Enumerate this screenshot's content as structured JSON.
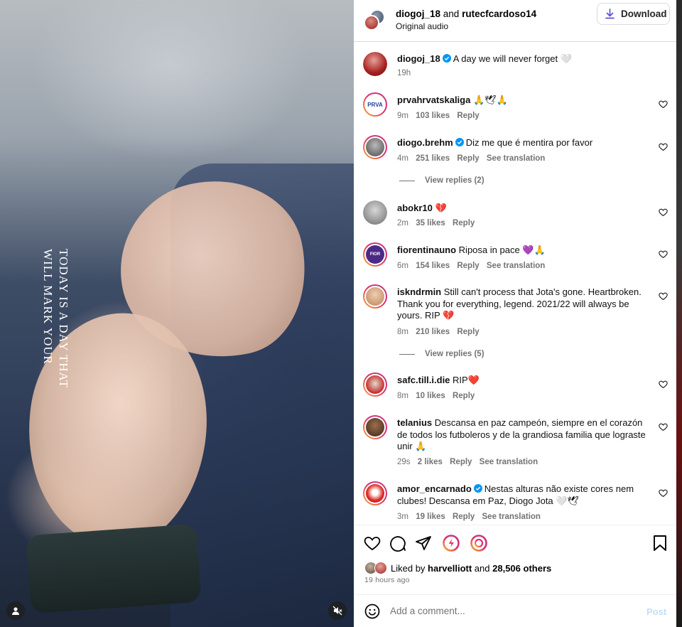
{
  "media": {
    "overlay_lines": [
      "TODAY IS A DAY THAT",
      "WILL MARK YOUR"
    ]
  },
  "header": {
    "user1": "diogoj_18",
    "and": "and",
    "user2": "rutecfcardoso14",
    "audio": "Original audio",
    "download_label": "Download"
  },
  "caption": {
    "user": "diogoj_18",
    "text": "A day we will never forget 🤍",
    "time": "19h"
  },
  "labels": {
    "reply": "Reply",
    "see_translation": "See translation"
  },
  "comments": [
    {
      "user": "prvahrvatskaliga",
      "verified": false,
      "text": "🙏🕊🙏",
      "time": "9m",
      "likes": "103 likes",
      "translation": false
    },
    {
      "user": "diogo.brehm",
      "verified": true,
      "text": "Diz me que é mentira por favor",
      "time": "4m",
      "likes": "251 likes",
      "translation": true,
      "replies": "View replies (2)"
    },
    {
      "user": "abokr10",
      "verified": false,
      "text": "💔",
      "time": "2m",
      "likes": "35 likes",
      "translation": false
    },
    {
      "user": "fiorentinauno",
      "verified": false,
      "text": "Riposa in pace 💜🙏",
      "time": "6m",
      "likes": "154 likes",
      "translation": true
    },
    {
      "user": "iskndrmin",
      "verified": false,
      "text": "Still can't process that Jota's gone. Heartbroken. Thank you for everything, legend. 2021/22 will always be yours. RIP 💔",
      "time": "8m",
      "likes": "210 likes",
      "translation": false,
      "replies": "View replies (5)"
    },
    {
      "user": "safc.till.i.die",
      "verified": false,
      "text": "RIP❤️",
      "time": "8m",
      "likes": "10 likes",
      "translation": false
    },
    {
      "user": "telanius",
      "verified": false,
      "text": "Descansa en paz campeón, siempre en el corazón de todos los futboleros y de la grandiosa familia que lograste unir 🙏",
      "time": "29s",
      "likes": "2 likes",
      "translation": true
    },
    {
      "user": "amor_encarnado",
      "verified": true,
      "text": "Nestas alturas não existe cores nem clubes! Descansa em Paz, Diogo Jota 🤍🕊",
      "time": "3m",
      "likes": "19 likes",
      "translation": true
    }
  ],
  "likes_bar": {
    "prefix": "Liked by",
    "user": "harvelliott",
    "and": "and",
    "others": "28,506 others",
    "time": "19 hours ago"
  },
  "add_comment": {
    "placeholder": "Add a comment...",
    "post_label": "Post"
  },
  "colors": {
    "verified": "#0095f6",
    "post_disabled": "#c0dffd",
    "story_ring_start": "#f9b233",
    "story_ring_end": "#c13584"
  }
}
